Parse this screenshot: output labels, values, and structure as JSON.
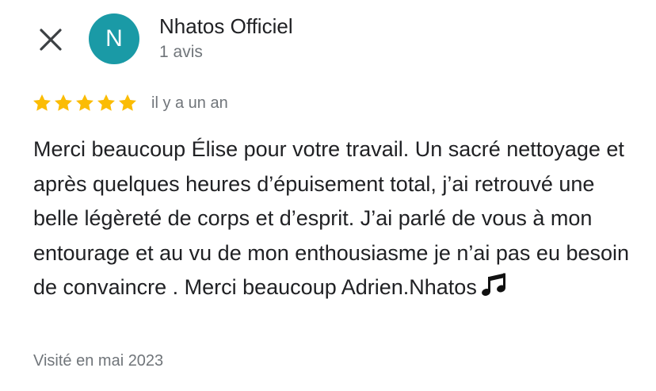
{
  "header": {
    "close_icon": "close-icon",
    "avatar_letter": "N",
    "avatar_color": "#1a9aa6",
    "author_name": "Nhatos Officiel",
    "review_count": "1 avis"
  },
  "review": {
    "rating": 5,
    "max_rating": 5,
    "star_color": "#fbbc04",
    "time_ago": "il y a un an",
    "text": "Merci beaucoup Élise pour votre travail. Un sacré nettoyage et après quelques heures d’épuisement total, j’ai retrouvé une belle légèreté de corps et d’esprit. J’ai parlé de vous à mon entourage et au vu de mon enthousiasme je n’ai pas eu besoin de convaincre . Merci beaucoup Adrien.Nhatos",
    "trailing_icon": "music-notes-icon",
    "visited": "Visité en mai 2023"
  }
}
